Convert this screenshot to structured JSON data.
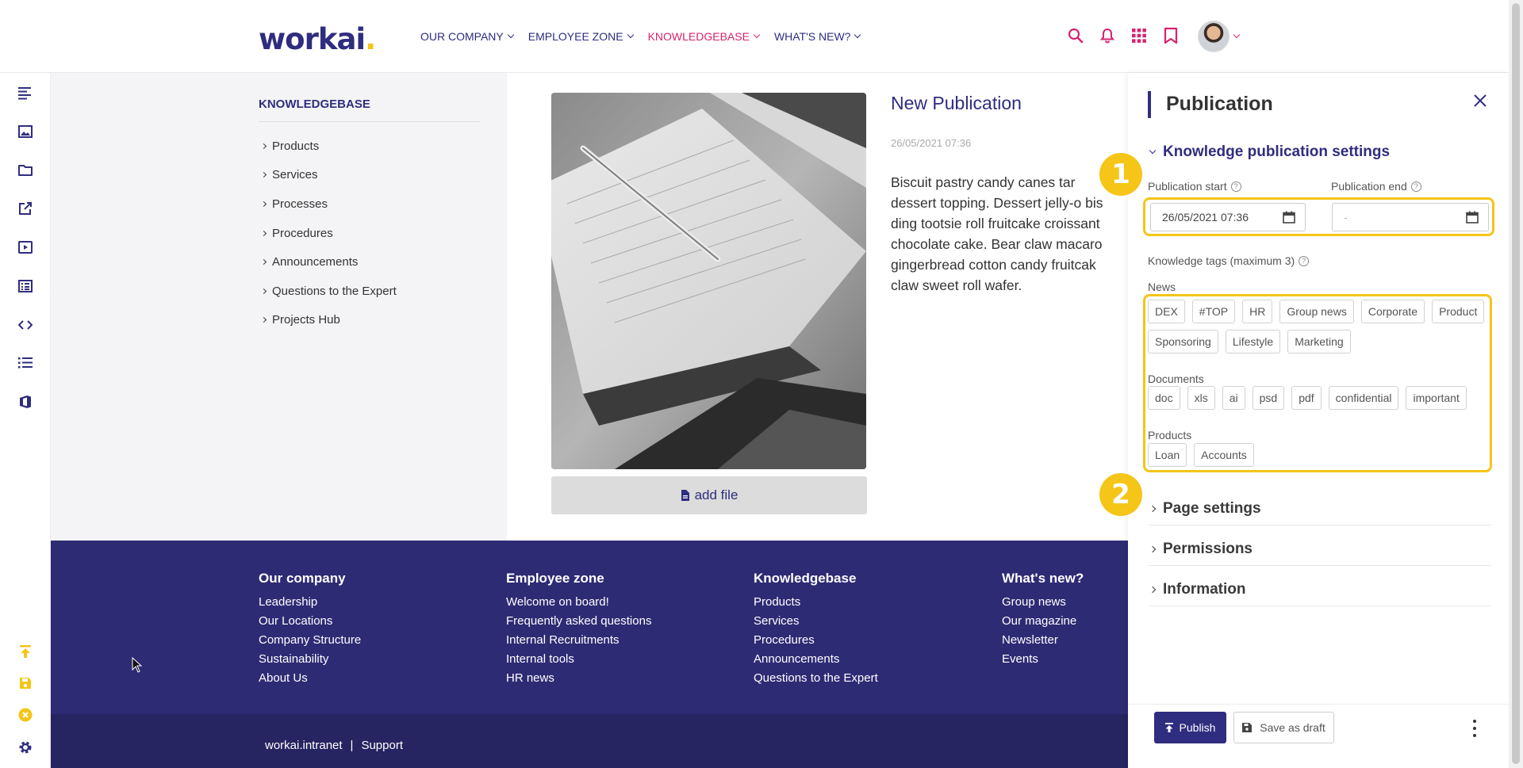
{
  "header": {
    "logo": "workai",
    "logo_dot": ".",
    "nav": [
      {
        "label": "OUR COMPANY",
        "active": false
      },
      {
        "label": "EMPLOYEE ZONE",
        "active": false
      },
      {
        "label": "KNOWLEDGEBASE",
        "active": true
      },
      {
        "label": "WHAT'S NEW?",
        "active": false
      }
    ],
    "icons": [
      "search-icon",
      "bell-icon",
      "apps-grid-icon",
      "bookmark-icon"
    ],
    "accent_color": "#d6246e"
  },
  "left_rail": {
    "top_icons": [
      "align-left-icon",
      "image-icon",
      "folder-icon",
      "external-link-icon",
      "play-icon",
      "list-alt-icon",
      "code-icon",
      "list-icon",
      "office-icon"
    ],
    "bottom_icons": [
      "publish-icon",
      "save-icon",
      "cancel-icon",
      "settings-icon"
    ]
  },
  "kb_sidebar": {
    "title": "KNOWLEDGEBASE",
    "items": [
      "Products",
      "Services",
      "Processes",
      "Procedures",
      "Announcements",
      "Questions to the Expert",
      "Projects Hub"
    ]
  },
  "article": {
    "title": "New Publication",
    "date": "26/05/2021 07:36",
    "body_lines": [
      "Biscuit pastry candy canes tar",
      "dessert topping. Dessert jelly-o bis",
      "ding tootsie roll fruitcake croissant",
      "chocolate cake. Bear claw macaro",
      "gingerbread cotton candy fruitcak",
      "claw sweet roll wafer."
    ],
    "add_file_label": "add file"
  },
  "footer": {
    "columns": [
      {
        "title": "Our company",
        "links": [
          "Leadership",
          "Our Locations",
          "Company Structure",
          "Sustainability",
          "About Us"
        ]
      },
      {
        "title": "Employee zone",
        "links": [
          "Welcome on board!",
          "Frequently asked questions",
          "Internal Recruitments",
          "Internal tools",
          "HR news"
        ]
      },
      {
        "title": "Knowledgebase",
        "links": [
          "Products",
          "Services",
          "Procedures",
          "Announcements",
          "Questions to the Expert"
        ]
      },
      {
        "title": "What's new?",
        "links": [
          "Group news",
          "Our magazine",
          "Newsletter",
          "Events"
        ]
      }
    ],
    "bottom_links": [
      "workai.intranet",
      "|",
      "Support"
    ]
  },
  "panel": {
    "title": "Publication",
    "sections": {
      "knowledge": "Knowledge publication settings",
      "page": "Page settings",
      "permissions": "Permissions",
      "information": "Information"
    },
    "publication_start_label": "Publication start",
    "publication_start_value": "26/05/2021 07:36",
    "publication_end_label": "Publication end",
    "publication_end_value": "-",
    "tags_label": "Knowledge tags (maximum 3)",
    "tag_groups": [
      {
        "name": "News",
        "rows": [
          [
            "DEX",
            "#TOP",
            "HR",
            "Group news",
            "Corporate",
            "Product"
          ],
          [
            "Sponsoring",
            "Lifestyle",
            "Marketing"
          ]
        ]
      },
      {
        "name": "Documents",
        "rows": [
          [
            "doc",
            "xls",
            "ai",
            "psd",
            "pdf",
            "confidential",
            "important"
          ]
        ]
      },
      {
        "name": "Products",
        "rows": [
          [
            "Loan",
            "Accounts"
          ]
        ]
      }
    ],
    "publish_label": "Publish",
    "save_draft_label": "Save as draft"
  },
  "annotations": {
    "badge1": "1",
    "badge2": "2",
    "highlight_color": "#f5c518"
  }
}
